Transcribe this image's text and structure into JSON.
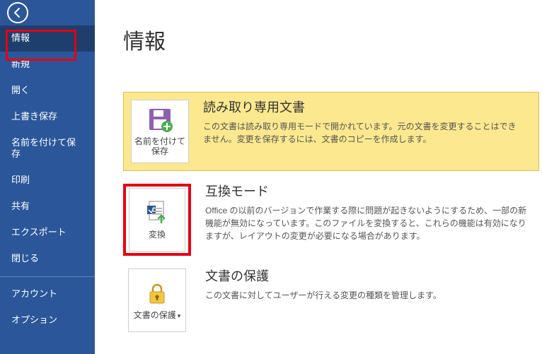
{
  "sidebar": {
    "items": [
      {
        "label": "情報"
      },
      {
        "label": "新規"
      },
      {
        "label": "開く"
      },
      {
        "label": "上書き保存"
      },
      {
        "label": "名前を付けて保存"
      },
      {
        "label": "印刷"
      },
      {
        "label": "共有"
      },
      {
        "label": "エクスポート"
      },
      {
        "label": "閉じる"
      },
      {
        "label": "アカウント"
      },
      {
        "label": "オプション"
      }
    ]
  },
  "main": {
    "title": "情報",
    "sections": [
      {
        "tile_label": "名前を付けて保存",
        "title": "読み取り専用文書",
        "desc": "この文書は読み取り専用モードで開かれています。元の文書を変更することはできません。変更を保存するには、文書のコピーを作成します。"
      },
      {
        "tile_label": "変換",
        "title": "互換モード",
        "desc": "Office の以前のバージョンで作業する際に問題が起きないようにするため、一部の新機能が無効になっています。このファイルを変換すると、これらの機能は有効になりますが、レイアウトの変更が必要になる場合があります。"
      },
      {
        "tile_label": "文書の保護",
        "tile_dropdown": true,
        "title": "文書の保護",
        "desc": "この文書に対してユーザーが行える変更の種類を管理します。"
      }
    ]
  },
  "colors": {
    "accent": "#2b579a",
    "highlight": "#e60012"
  }
}
